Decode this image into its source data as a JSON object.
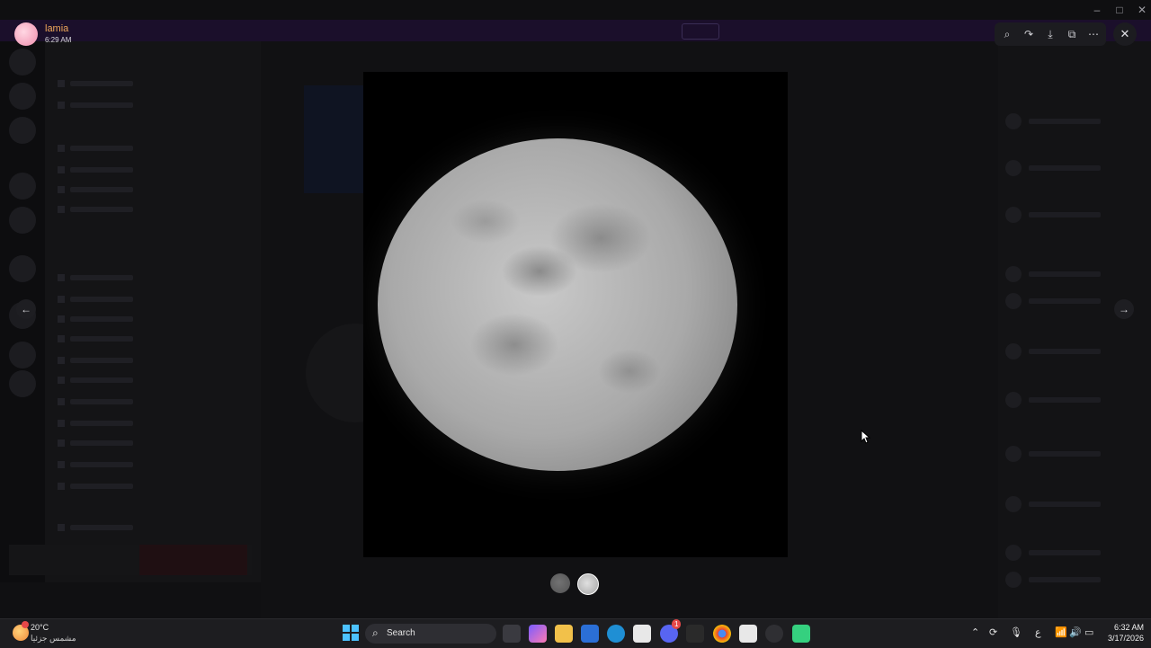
{
  "viewer": {
    "uploader_name": "lamia",
    "uploader_time": "6:29 AM",
    "toolbar_icons": [
      "zoom-in-icon",
      "forward-icon",
      "download-icon",
      "open-external-icon",
      "more-icon"
    ],
    "image_count": 2,
    "selected_index": 1
  },
  "taskbar": {
    "weather_temp": "20°C",
    "weather_condition": "مشمس جزئيا",
    "search_label": "Search",
    "discord_badge": "1",
    "keyboard_lang": "ع",
    "clock_time": "6:32 AM",
    "clock_date": "3/17/2026"
  },
  "colors": {
    "uploader_name": "#f0a85a",
    "toolbar_bg": "#1c1c20",
    "taskbar_bg": "#1d1d20"
  }
}
